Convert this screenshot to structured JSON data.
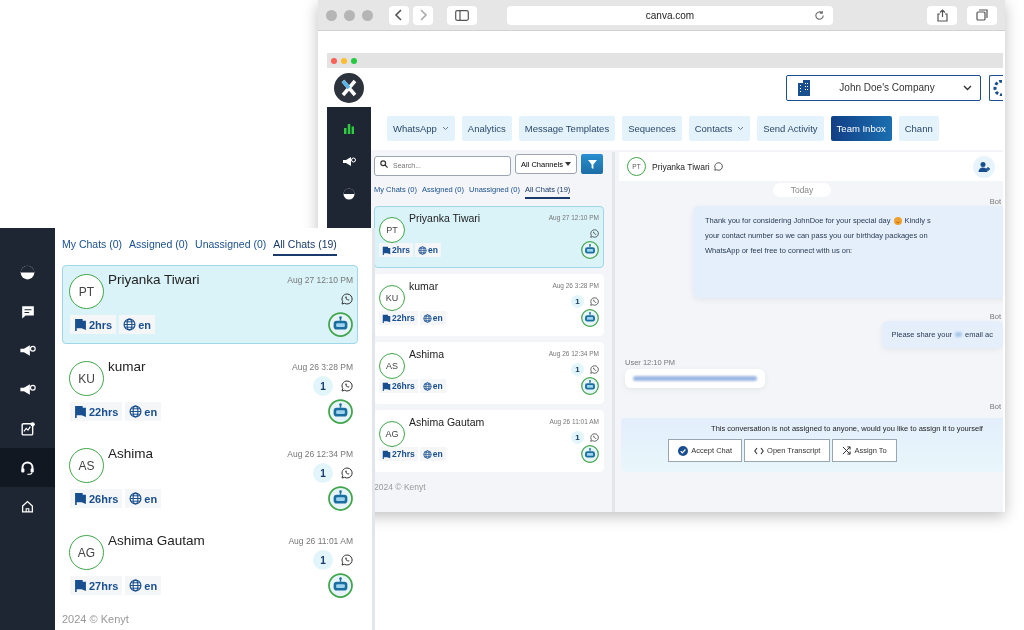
{
  "browser": {
    "url": "canva.com"
  },
  "app": {
    "company": "John Doe's Company",
    "sidebar": [
      {
        "kind": "chart",
        "selected": false
      },
      {
        "kind": "megaphone",
        "selected": false
      },
      {
        "kind": "pie",
        "selected": false
      }
    ],
    "nav": [
      {
        "label": "WhatsApp",
        "dropdown": true,
        "selected": false
      },
      {
        "label": "Analytics",
        "dropdown": false,
        "selected": false
      },
      {
        "label": "Message Templates",
        "dropdown": false,
        "selected": false
      },
      {
        "label": "Sequences",
        "dropdown": false,
        "selected": false
      },
      {
        "label": "Contacts",
        "dropdown": true,
        "selected": false
      },
      {
        "label": "Send Activity",
        "dropdown": false,
        "selected": false
      },
      {
        "label": "Team Inbox",
        "dropdown": false,
        "selected": true
      },
      {
        "label": "Chann",
        "dropdown": false,
        "selected": false
      }
    ],
    "search": {
      "placeholder": "Search..."
    },
    "channel_filter": "All Channels",
    "tabs": [
      {
        "label": "My Chats (0)",
        "selected": false
      },
      {
        "label": "Assigned (0)",
        "selected": false
      },
      {
        "label": "Unassigned (0)",
        "selected": false
      },
      {
        "label": "All Chats (19)",
        "selected": true
      }
    ],
    "chats": [
      {
        "initials": "PT",
        "name": "Priyanka Tiwari",
        "time": "Aug 27 12:10 PM",
        "wait": "2hrs",
        "lang": "en",
        "selected": true
      },
      {
        "initials": "KU",
        "name": "kumar",
        "time": "Aug 26 3:28 PM",
        "unread": "1",
        "wait": "22hrs",
        "lang": "en",
        "selected": false
      },
      {
        "initials": "AS",
        "name": "Ashima",
        "time": "Aug 26 12:34 PM",
        "unread": "1",
        "wait": "26hrs",
        "lang": "en",
        "selected": false
      },
      {
        "initials": "AG",
        "name": "Ashima Gautam",
        "time": "Aug 26 11:01 AM",
        "unread": "1",
        "wait": "27hrs",
        "lang": "en",
        "selected": false
      }
    ],
    "footer": "2024 © Kenyt",
    "conversation": {
      "contact": {
        "initials": "PT",
        "name": "Priyanka Tiwari"
      },
      "date": "Today",
      "messages": [
        {
          "sender": "Bot",
          "kind": "text",
          "lines": [
            [
              {
                "kind": "text",
                "text": "Thank you for considering  JohnDoe  for your special day"
              },
              {
                "kind": "emoji"
              },
              {
                "kind": "text",
                "text": "Kindly s"
              }
            ],
            [
              {
                "kind": "text",
                "text": "your contact number so we can pass you our birthday packages on"
              }
            ],
            [
              {
                "kind": "text",
                "text": "WhatsApp or feel free to connect with us on:"
              }
            ]
          ]
        },
        {
          "sender": "Bot",
          "kind": "text",
          "lines": [
            [
              {
                "kind": "text",
                "text": "Please share your"
              },
              {
                "kind": "blur"
              },
              {
                "kind": "text",
                "text": "email ac"
              }
            ]
          ]
        },
        {
          "sender": "User 12:10 PM",
          "kind": "blurred"
        },
        {
          "sender": "Bot",
          "kind": "cut"
        }
      ],
      "assign_banner": {
        "text": "This conversation is not assigned to anyone, would you like to assign it to yourself",
        "buttons": [
          {
            "label": "Accept Chat",
            "kind": "accept"
          },
          {
            "label": "Open Transcript",
            "kind": "transcript"
          },
          {
            "label": "Assign To",
            "kind": "assign"
          }
        ]
      }
    }
  },
  "inset": {
    "sidebar": [
      {
        "kind": "pie",
        "selected": false
      },
      {
        "kind": "chat",
        "selected": false
      },
      {
        "kind": "megaphone",
        "selected": false
      },
      {
        "kind": "megaphone",
        "selected": false
      },
      {
        "kind": "report",
        "selected": false
      },
      {
        "kind": "headset",
        "selected": true
      },
      {
        "kind": "home",
        "selected": false
      }
    ],
    "tabs": [
      {
        "label": "My Chats (0)",
        "selected": false
      },
      {
        "label": "Assigned (0)",
        "selected": false
      },
      {
        "label": "Unassigned (0)",
        "selected": false
      },
      {
        "label": "All Chats (19)",
        "selected": true
      }
    ],
    "chats": [
      {
        "initials": "PT",
        "name": "Priyanka Tiwari",
        "time": "Aug 27 12:10 PM",
        "wait": "2hrs",
        "lang": "en",
        "selected": true
      },
      {
        "initials": "KU",
        "name": "kumar",
        "time": "Aug 26 3:28 PM",
        "unread": "1",
        "wait": "22hrs",
        "lang": "en",
        "selected": false
      },
      {
        "initials": "AS",
        "name": "Ashima",
        "time": "Aug 26 12:34 PM",
        "unread": "1",
        "wait": "26hrs",
        "lang": "en",
        "selected": false
      },
      {
        "initials": "AG",
        "name": "Ashima Gautam",
        "time": "Aug 26 11:01 AM",
        "unread": "1",
        "wait": "27hrs",
        "lang": "en",
        "selected": false
      }
    ],
    "footer": "2024 © Kenyt"
  }
}
